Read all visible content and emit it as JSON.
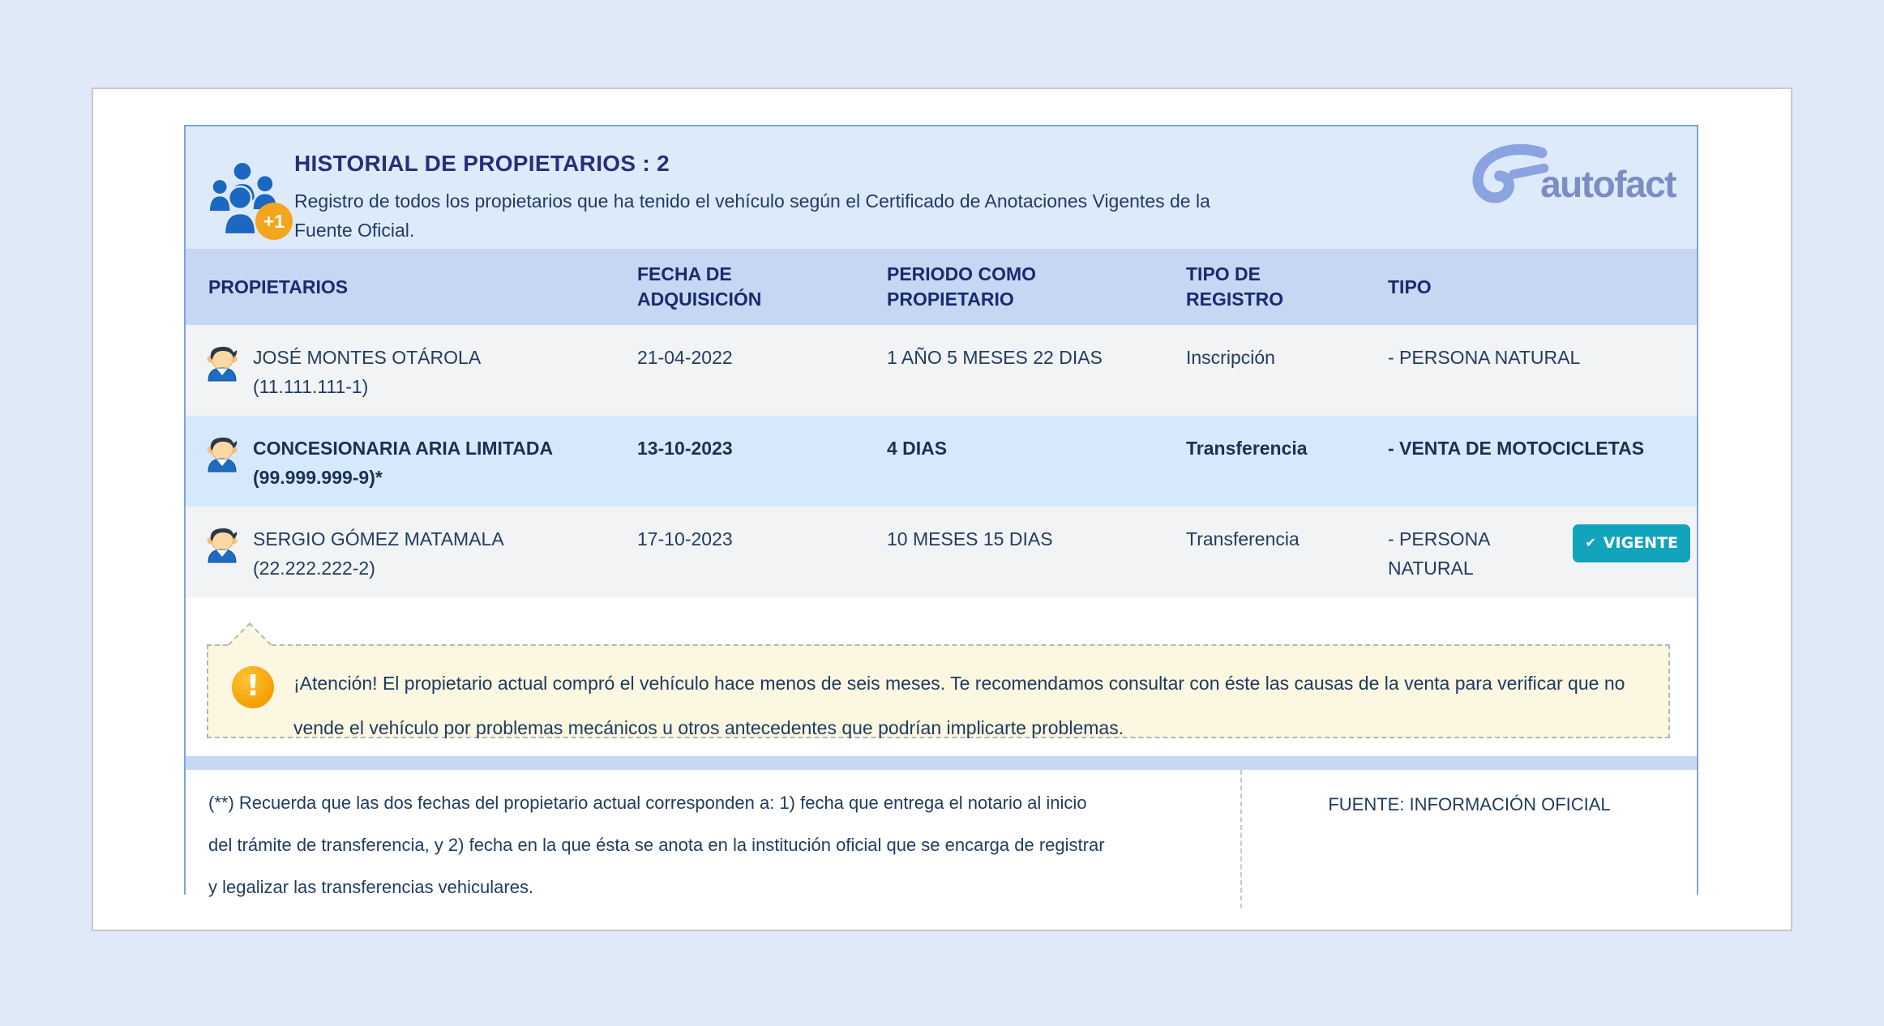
{
  "header": {
    "title": "HISTORIAL DE PROPIETARIOS : 2",
    "subtitle": "Registro de todos los propietarios que ha tenido el vehículo según el Certificado de Anotaciones Vigentes de la Fuente Oficial.",
    "icon_badge": "+1",
    "logo_text": "autofact"
  },
  "table": {
    "columns": [
      "PROPIETARIOS",
      "FECHA DE ADQUISICIÓN",
      "PERIODO COMO PROPIETARIO",
      "TIPO DE REGISTRO",
      "TIPO"
    ],
    "rows": [
      {
        "name": "JOSÉ MONTES OTÁROLA",
        "rut": "(11.111.111-1)",
        "fecha": "21-04-2022",
        "periodo": "1 AÑO 5 MESES 22 DIAS",
        "tipo_registro": "Inscripción",
        "tipo": "- PERSONA NATURAL",
        "highlight": false,
        "badge": ""
      },
      {
        "name": "CONCESIONARIA ARIA LIMITADA",
        "rut": "(99.999.999-9)*",
        "fecha": "13-10-2023",
        "periodo": "4 DIAS",
        "tipo_registro": "Transferencia",
        "tipo": "- VENTA DE MOTOCICLETAS",
        "highlight": true,
        "badge": ""
      },
      {
        "name": "SERGIO GÓMEZ MATAMALA",
        "rut": "(22.222.222-2)",
        "fecha": "17-10-2023",
        "periodo": "10 MESES 15 DIAS",
        "tipo_registro": "Transferencia",
        "tipo": "- PERSONA NATURAL",
        "highlight": false,
        "badge": "VIGENTE"
      }
    ]
  },
  "warning": {
    "text": "¡Atención! El propietario actual compró el vehículo hace menos de seis meses. Te recomendamos consultar con éste las causas de la venta para verificar que no vende el vehículo por problemas mecánicos u otros antecedentes que podrían implicarte problemas.",
    "icon_glyph": "!"
  },
  "footer": {
    "note": "(**) Recuerda que las dos fechas del propietario actual corresponden a: 1) fecha que entrega el notario al inicio del trámite de transferencia, y 2) fecha en la que ésta se anota en la institución oficial que se encarga de registrar y legalizar las transferencias vehiculares.",
    "source": "FUENTE: INFORMACIÓN OFICIAL"
  },
  "icons": {
    "badge_check": "✔",
    "owners_group": "people-group-icon",
    "row_avatar": "person-avatar-icon"
  },
  "colors": {
    "page_bg": "#dfe9f7",
    "panel_border": "#7ea4da",
    "header_band": "#ddeafa",
    "table_header_bg": "#c5d7f2",
    "row_bg": "#f2f3f5",
    "row_highlight_bg": "#d6e9fc",
    "title_navy": "#25307b",
    "badge_teal": "#12a4bc",
    "warn_orange": "#f5a51d",
    "bubble_bg": "#fbf7e0",
    "logo_blue": "#7c8cc4"
  }
}
